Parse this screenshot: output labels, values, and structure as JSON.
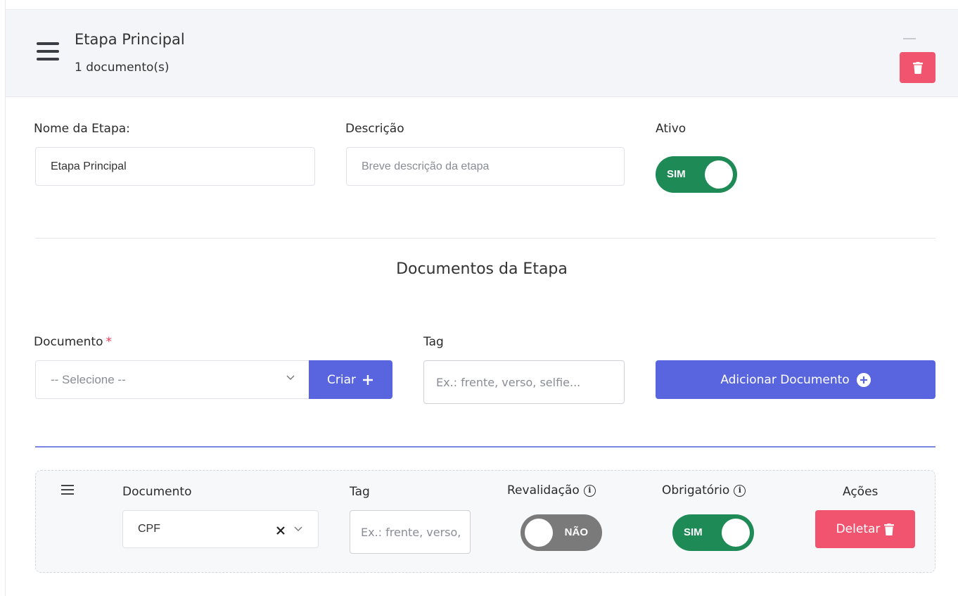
{
  "stage": {
    "title": "Etapa Principal",
    "subtitle": "1 documento(s)",
    "minimize_icon": "minus-icon",
    "delete_icon": "trash-icon"
  },
  "form": {
    "name_label": "Nome da Etapa:",
    "name_value": "Etapa Principal",
    "description_label": "Descrição",
    "description_placeholder": "Breve descrição da etapa",
    "active_label": "Ativo",
    "active_toggle": "SIM"
  },
  "documents": {
    "section_title": "Documentos da Etapa",
    "document_label": "Documento",
    "required_mark": "*",
    "select_placeholder": "-- Selecione --",
    "create_button": "Criar",
    "tag_label": "Tag",
    "tag_placeholder": "Ex.: frente, verso, selfie...",
    "add_button": "Adicionar Documento"
  },
  "doc_table": {
    "headers": {
      "document": "Documento",
      "tag": "Tag",
      "revalidation": "Revalidação",
      "required": "Obrigatório",
      "actions": "Ações"
    },
    "row": {
      "document_value": "CPF",
      "tag_placeholder": "Ex.: frente, verso,",
      "revalidation_toggle": "NÃO",
      "required_toggle": "SIM",
      "delete_button": "Deletar"
    }
  },
  "colors": {
    "primary": "#5865df",
    "danger": "#f0546e",
    "success": "#1e8a56",
    "toggle_off": "#7a7a7a"
  }
}
